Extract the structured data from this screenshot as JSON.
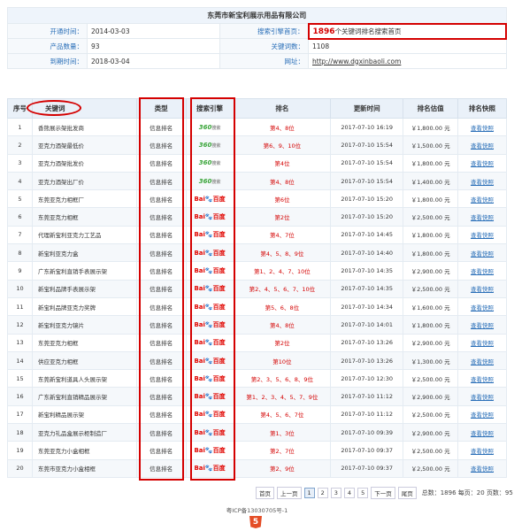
{
  "company": "东莞市新宝利展示用品有限公司",
  "info": {
    "open_time_label": "开通时间：",
    "open_time": "2014-03-03",
    "product_count_label": "产品数量：",
    "product_count": "93",
    "expire_label": "到期时间：",
    "expire": "2018-03-04",
    "engine_home_label": "搜索引擎首页：",
    "engine_home_count": "1896",
    "engine_home_suffix": "个关键词排名搜索首页",
    "keyword_count_label": "关键词数：",
    "keyword_count": "1108",
    "site_label": "网址：",
    "site": "http://www.dgxinbaoli.com"
  },
  "table": {
    "headers": [
      "序号",
      "关键词",
      "类型",
      "搜索引擎",
      "排名",
      "更新时间",
      "排名估值",
      "排名快照"
    ],
    "rows": [
      {
        "no": "1",
        "kw": "香熊展示架批发商",
        "type": "信息排名",
        "engine": "360",
        "rank_prefix": "第",
        "rank": "4、8",
        "rank_suffix": "位",
        "time": "2017-07-10 16:19",
        "value": "￥1,800.00 元",
        "snap": "查看快照"
      },
      {
        "no": "2",
        "kw": "亚克力酒架最低价",
        "type": "信息排名",
        "engine": "360",
        "rank_prefix": "第",
        "rank": "6、9、10",
        "rank_suffix": "位",
        "time": "2017-07-10 15:54",
        "value": "￥1,500.00 元",
        "snap": "查看快照"
      },
      {
        "no": "3",
        "kw": "亚克力酒架批发价",
        "type": "信息排名",
        "engine": "360",
        "rank_prefix": "第",
        "rank": "4",
        "rank_suffix": "位",
        "time": "2017-07-10 15:54",
        "value": "￥1,800.00 元",
        "snap": "查看快照"
      },
      {
        "no": "4",
        "kw": "亚克力酒架出厂价",
        "type": "信息排名",
        "engine": "360",
        "rank_prefix": "第",
        "rank": "4、8",
        "rank_suffix": "位",
        "time": "2017-07-10 15:54",
        "value": "￥1,400.00 元",
        "snap": "查看快照"
      },
      {
        "no": "5",
        "kw": "东莞亚克力相框厂",
        "type": "信息排名",
        "engine": "baidu",
        "rank_prefix": "第",
        "rank": "6",
        "rank_suffix": "位",
        "time": "2017-07-10 15:20",
        "value": "￥1,800.00 元",
        "snap": "查看快照"
      },
      {
        "no": "6",
        "kw": "东莞亚克力相框",
        "type": "信息排名",
        "engine": "baidu",
        "rank_prefix": "第",
        "rank": "2",
        "rank_suffix": "位",
        "time": "2017-07-10 15:20",
        "value": "￥2,500.00 元",
        "snap": "查看快照"
      },
      {
        "no": "7",
        "kw": "代理新宝利亚克力工艺品",
        "type": "信息排名",
        "engine": "baidu",
        "rank_prefix": "第",
        "rank": "4、7",
        "rank_suffix": "位",
        "time": "2017-07-10 14:45",
        "value": "￥1,800.00 元",
        "snap": "查看快照"
      },
      {
        "no": "8",
        "kw": "新宝利亚克力盒",
        "type": "信息排名",
        "engine": "baidu",
        "rank_prefix": "第",
        "rank": "4、5、8、9",
        "rank_suffix": "位",
        "time": "2017-07-10 14:40",
        "value": "￥1,800.00 元",
        "snap": "查看快照"
      },
      {
        "no": "9",
        "kw": "广东新宝利直销手表展示架",
        "type": "信息排名",
        "engine": "baidu",
        "rank_prefix": "第",
        "rank": "1、2、4、7、10",
        "rank_suffix": "位",
        "time": "2017-07-10 14:35",
        "value": "￥2,900.00 元",
        "snap": "查看快照"
      },
      {
        "no": "10",
        "kw": "新宝利品牌手表展示架",
        "type": "信息排名",
        "engine": "baidu",
        "rank_prefix": "第",
        "rank": "2、4、5、6、7、10",
        "rank_suffix": "位",
        "time": "2017-07-10 14:35",
        "value": "￥2,500.00 元",
        "snap": "查看快照"
      },
      {
        "no": "11",
        "kw": "新宝利品牌亚克力奖牌",
        "type": "信息排名",
        "engine": "baidu",
        "rank_prefix": "第",
        "rank": "5、6、8",
        "rank_suffix": "位",
        "time": "2017-07-10 14:34",
        "value": "￥1,600.00 元",
        "snap": "查看快照"
      },
      {
        "no": "12",
        "kw": "新宝利亚克力镜片",
        "type": "信息排名",
        "engine": "baidu",
        "rank_prefix": "第",
        "rank": "4、8",
        "rank_suffix": "位",
        "time": "2017-07-10 14:01",
        "value": "￥1,800.00 元",
        "snap": "查看快照"
      },
      {
        "no": "13",
        "kw": "东莞亚克力相框",
        "type": "信息排名",
        "engine": "baidu",
        "rank_prefix": "第",
        "rank": "2",
        "rank_suffix": "位",
        "time": "2017-07-10 13:26",
        "value": "￥2,900.00 元",
        "snap": "查看快照"
      },
      {
        "no": "14",
        "kw": "供应亚克力相框",
        "type": "信息排名",
        "engine": "baidu",
        "rank_prefix": "第",
        "rank": "10",
        "rank_suffix": "位",
        "time": "2017-07-10 13:26",
        "value": "￥1,300.00 元",
        "snap": "查看快照"
      },
      {
        "no": "15",
        "kw": "东莞新宝利道具人头展示架",
        "type": "信息排名",
        "engine": "baidu",
        "rank_prefix": "第",
        "rank": "2、3、5、6、8、9",
        "rank_suffix": "位",
        "time": "2017-07-10 12:30",
        "value": "￥2,500.00 元",
        "snap": "查看快照"
      },
      {
        "no": "16",
        "kw": "广东新宝利直销精品展示架",
        "type": "信息排名",
        "engine": "baidu",
        "rank_prefix": "第",
        "rank": "1、2、3、4、5、7、9",
        "rank_suffix": "位",
        "time": "2017-07-10 11:12",
        "value": "￥2,900.00 元",
        "snap": "查看快照"
      },
      {
        "no": "17",
        "kw": "新宝利精品展示架",
        "type": "信息排名",
        "engine": "baidu",
        "rank_prefix": "第",
        "rank": "4、5、6、7",
        "rank_suffix": "位",
        "time": "2017-07-10 11:12",
        "value": "￥2,500.00 元",
        "snap": "查看快照"
      },
      {
        "no": "18",
        "kw": "亚克力礼品盒展示柜制造厂",
        "type": "信息排名",
        "engine": "baidu",
        "rank_prefix": "第",
        "rank": "1、3",
        "rank_suffix": "位",
        "time": "2017-07-10 09:39",
        "value": "￥2,900.00 元",
        "snap": "查看快照"
      },
      {
        "no": "19",
        "kw": "东莞亚克力小盒相框",
        "type": "信息排名",
        "engine": "baidu",
        "rank_prefix": "第",
        "rank": "2、7",
        "rank_suffix": "位",
        "time": "2017-07-10 09:37",
        "value": "￥2,500.00 元",
        "snap": "查看快照"
      },
      {
        "no": "20",
        "kw": "东莞市亚克力小盒相框",
        "type": "信息排名",
        "engine": "baidu",
        "rank_prefix": "第",
        "rank": "2、9",
        "rank_suffix": "位",
        "time": "2017-07-10 09:37",
        "value": "￥2,500.00 元",
        "snap": "查看快照"
      }
    ]
  },
  "engine_logos": {
    "360": {
      "main": "360",
      "sub": "搜索"
    },
    "baidu": {
      "b1": "Bai",
      "paw": "🐾",
      "b2": "百度"
    }
  },
  "pager": {
    "first": "首页",
    "prev": "上一页",
    "pages": [
      "1",
      "2",
      "3",
      "4",
      "5"
    ],
    "current": "1",
    "next": "下一页",
    "last": "尾页",
    "summary": "总数：1896 每页：20 页数：95"
  },
  "icp": "粤ICP备13030705号-1",
  "html5_badge": "5",
  "colors": {
    "accent_red": "#d40000",
    "link_blue": "#2a6fb8",
    "header_bg": "#eaf1f9"
  }
}
